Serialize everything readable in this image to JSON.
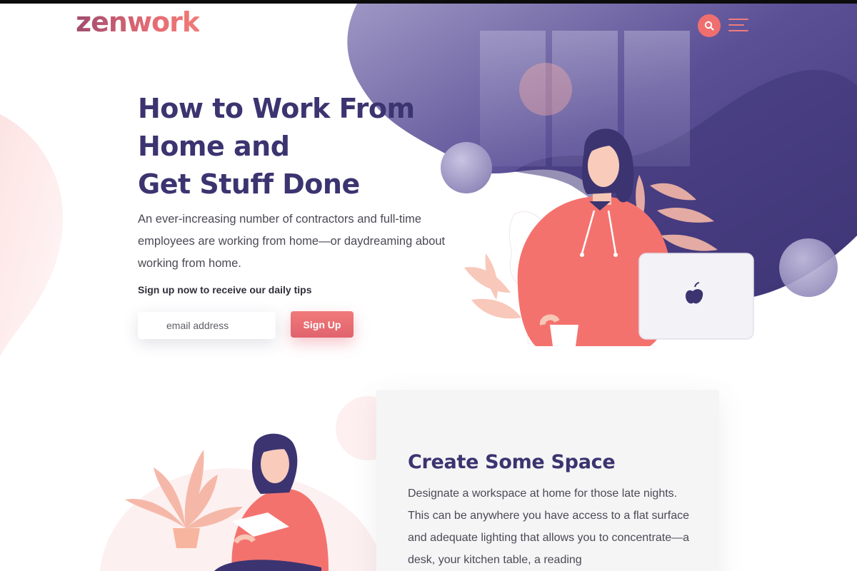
{
  "header": {
    "logo": "zenwork",
    "search_icon": "search-icon",
    "menu_icon": "hamburger-menu-icon"
  },
  "hero": {
    "title_lines": [
      "How to Work From",
      "Home and",
      "Get Stuff Done"
    ],
    "description": "An ever-increasing number of contractors and full-time employees are working from home—or daydreaming about working from home.",
    "signup_prompt": "Sign up now to receive our daily tips",
    "email_placeholder": "email address",
    "signup_button": "Sign Up"
  },
  "section": {
    "title": "Create Some Space",
    "text": "Designate a workspace at home for those late nights. This can be anywhere you have access to a flat surface and adequate lighting that allows you to concentrate—a desk, your kitchen table, a reading"
  },
  "colors": {
    "brand_purple": "#3b3470",
    "accent_coral": "#ef6f6f",
    "blob_purple": "#4a3f85",
    "card_bg": "#f5f5f6"
  }
}
